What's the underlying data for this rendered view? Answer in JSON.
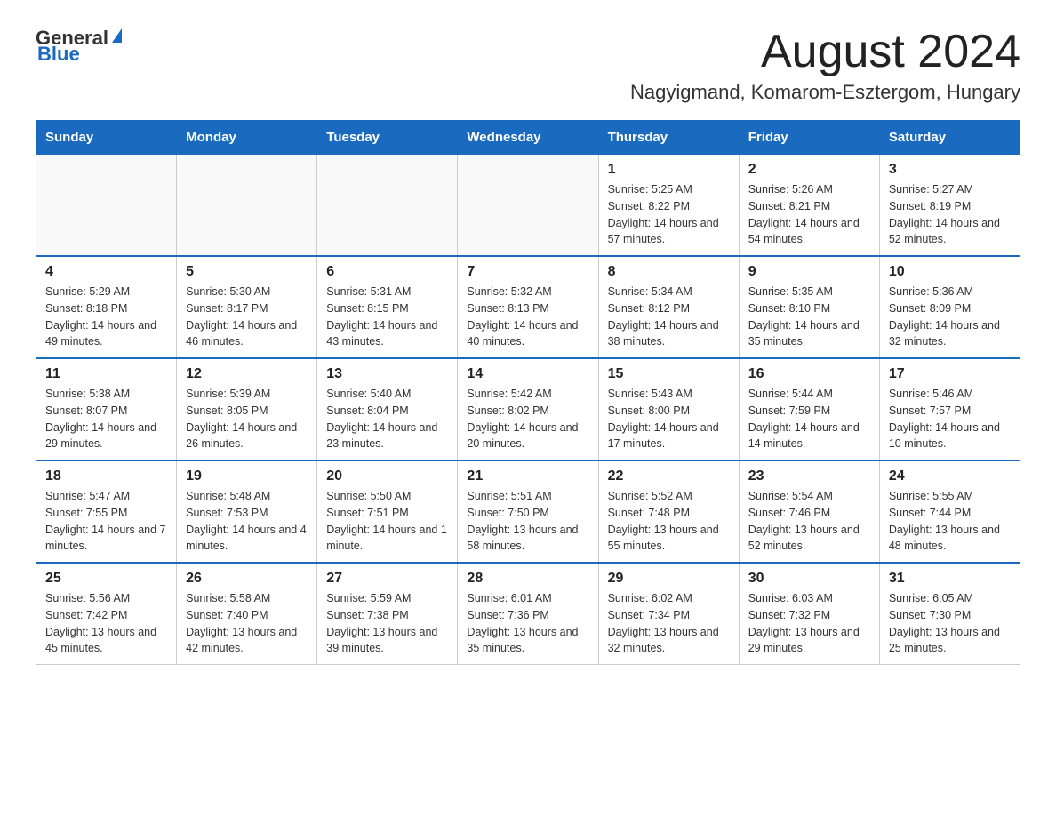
{
  "logo": {
    "text_general": "General",
    "text_blue": "Blue"
  },
  "title": {
    "month_year": "August 2024",
    "location": "Nagyigmand, Komarom-Esztergom, Hungary"
  },
  "weekdays": [
    "Sunday",
    "Monday",
    "Tuesday",
    "Wednesday",
    "Thursday",
    "Friday",
    "Saturday"
  ],
  "weeks": [
    {
      "days": [
        {
          "num": "",
          "info": ""
        },
        {
          "num": "",
          "info": ""
        },
        {
          "num": "",
          "info": ""
        },
        {
          "num": "",
          "info": ""
        },
        {
          "num": "1",
          "info": "Sunrise: 5:25 AM\nSunset: 8:22 PM\nDaylight: 14 hours and 57 minutes."
        },
        {
          "num": "2",
          "info": "Sunrise: 5:26 AM\nSunset: 8:21 PM\nDaylight: 14 hours and 54 minutes."
        },
        {
          "num": "3",
          "info": "Sunrise: 5:27 AM\nSunset: 8:19 PM\nDaylight: 14 hours and 52 minutes."
        }
      ]
    },
    {
      "days": [
        {
          "num": "4",
          "info": "Sunrise: 5:29 AM\nSunset: 8:18 PM\nDaylight: 14 hours and 49 minutes."
        },
        {
          "num": "5",
          "info": "Sunrise: 5:30 AM\nSunset: 8:17 PM\nDaylight: 14 hours and 46 minutes."
        },
        {
          "num": "6",
          "info": "Sunrise: 5:31 AM\nSunset: 8:15 PM\nDaylight: 14 hours and 43 minutes."
        },
        {
          "num": "7",
          "info": "Sunrise: 5:32 AM\nSunset: 8:13 PM\nDaylight: 14 hours and 40 minutes."
        },
        {
          "num": "8",
          "info": "Sunrise: 5:34 AM\nSunset: 8:12 PM\nDaylight: 14 hours and 38 minutes."
        },
        {
          "num": "9",
          "info": "Sunrise: 5:35 AM\nSunset: 8:10 PM\nDaylight: 14 hours and 35 minutes."
        },
        {
          "num": "10",
          "info": "Sunrise: 5:36 AM\nSunset: 8:09 PM\nDaylight: 14 hours and 32 minutes."
        }
      ]
    },
    {
      "days": [
        {
          "num": "11",
          "info": "Sunrise: 5:38 AM\nSunset: 8:07 PM\nDaylight: 14 hours and 29 minutes."
        },
        {
          "num": "12",
          "info": "Sunrise: 5:39 AM\nSunset: 8:05 PM\nDaylight: 14 hours and 26 minutes."
        },
        {
          "num": "13",
          "info": "Sunrise: 5:40 AM\nSunset: 8:04 PM\nDaylight: 14 hours and 23 minutes."
        },
        {
          "num": "14",
          "info": "Sunrise: 5:42 AM\nSunset: 8:02 PM\nDaylight: 14 hours and 20 minutes."
        },
        {
          "num": "15",
          "info": "Sunrise: 5:43 AM\nSunset: 8:00 PM\nDaylight: 14 hours and 17 minutes."
        },
        {
          "num": "16",
          "info": "Sunrise: 5:44 AM\nSunset: 7:59 PM\nDaylight: 14 hours and 14 minutes."
        },
        {
          "num": "17",
          "info": "Sunrise: 5:46 AM\nSunset: 7:57 PM\nDaylight: 14 hours and 10 minutes."
        }
      ]
    },
    {
      "days": [
        {
          "num": "18",
          "info": "Sunrise: 5:47 AM\nSunset: 7:55 PM\nDaylight: 14 hours and 7 minutes."
        },
        {
          "num": "19",
          "info": "Sunrise: 5:48 AM\nSunset: 7:53 PM\nDaylight: 14 hours and 4 minutes."
        },
        {
          "num": "20",
          "info": "Sunrise: 5:50 AM\nSunset: 7:51 PM\nDaylight: 14 hours and 1 minute."
        },
        {
          "num": "21",
          "info": "Sunrise: 5:51 AM\nSunset: 7:50 PM\nDaylight: 13 hours and 58 minutes."
        },
        {
          "num": "22",
          "info": "Sunrise: 5:52 AM\nSunset: 7:48 PM\nDaylight: 13 hours and 55 minutes."
        },
        {
          "num": "23",
          "info": "Sunrise: 5:54 AM\nSunset: 7:46 PM\nDaylight: 13 hours and 52 minutes."
        },
        {
          "num": "24",
          "info": "Sunrise: 5:55 AM\nSunset: 7:44 PM\nDaylight: 13 hours and 48 minutes."
        }
      ]
    },
    {
      "days": [
        {
          "num": "25",
          "info": "Sunrise: 5:56 AM\nSunset: 7:42 PM\nDaylight: 13 hours and 45 minutes."
        },
        {
          "num": "26",
          "info": "Sunrise: 5:58 AM\nSunset: 7:40 PM\nDaylight: 13 hours and 42 minutes."
        },
        {
          "num": "27",
          "info": "Sunrise: 5:59 AM\nSunset: 7:38 PM\nDaylight: 13 hours and 39 minutes."
        },
        {
          "num": "28",
          "info": "Sunrise: 6:01 AM\nSunset: 7:36 PM\nDaylight: 13 hours and 35 minutes."
        },
        {
          "num": "29",
          "info": "Sunrise: 6:02 AM\nSunset: 7:34 PM\nDaylight: 13 hours and 32 minutes."
        },
        {
          "num": "30",
          "info": "Sunrise: 6:03 AM\nSunset: 7:32 PM\nDaylight: 13 hours and 29 minutes."
        },
        {
          "num": "31",
          "info": "Sunrise: 6:05 AM\nSunset: 7:30 PM\nDaylight: 13 hours and 25 minutes."
        }
      ]
    }
  ]
}
